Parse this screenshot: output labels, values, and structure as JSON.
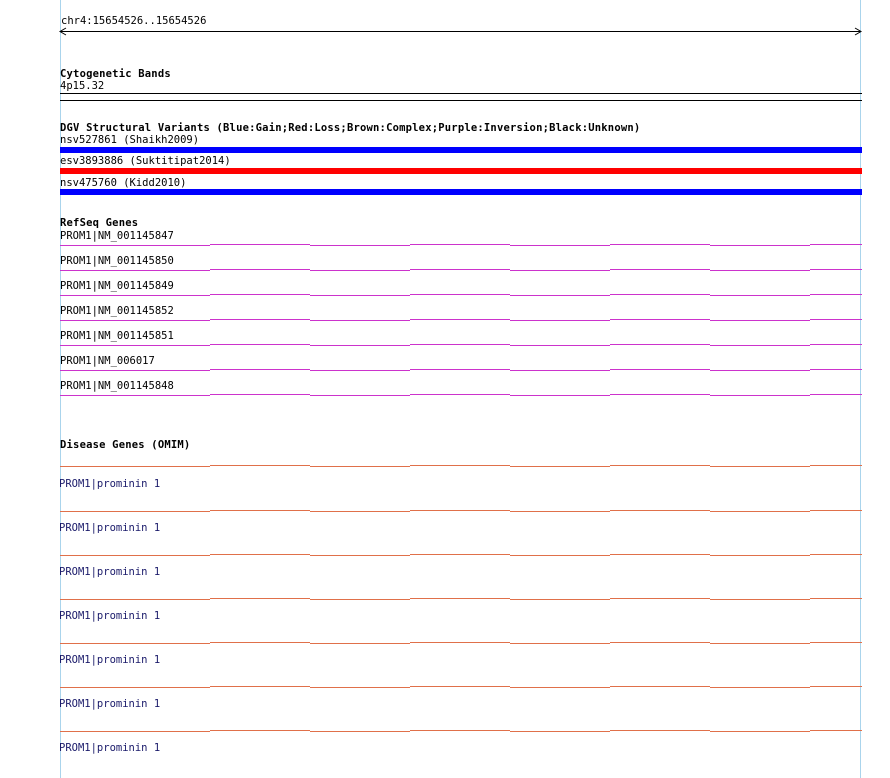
{
  "colors": {
    "guide": "#aad4ec",
    "gain": "#0000ff",
    "loss": "#ff0000",
    "refseq": "#cc33cc",
    "omim": "#e0704a"
  },
  "ruler": {
    "label": "chr4:15654526..15654526"
  },
  "cytoband": {
    "title": "Cytogenetic Bands",
    "band": "4p15.32"
  },
  "dgv": {
    "title": "DGV Structural Variants (Blue:Gain;Red:Loss;Brown:Complex;Purple:Inversion;Black:Unknown)",
    "variants": [
      {
        "label": "nsv527861 (Shaikh2009)",
        "color": "#0000ff"
      },
      {
        "label": "esv3893886 (Suktitipat2014)",
        "color": "#ff0000"
      },
      {
        "label": "nsv475760 (Kidd2010)",
        "color": "#0000ff"
      }
    ]
  },
  "refseq": {
    "title": "RefSeq Genes",
    "genes": [
      "PROM1|NM_001145847",
      "PROM1|NM_001145850",
      "PROM1|NM_001145849",
      "PROM1|NM_001145852",
      "PROM1|NM_001145851",
      "PROM1|NM_006017",
      "PROM1|NM_001145848"
    ]
  },
  "omim": {
    "title": "Disease Genes (OMIM)",
    "genes": [
      "PROM1|prominin 1",
      "PROM1|prominin 1",
      "PROM1|prominin 1",
      "PROM1|prominin 1",
      "PROM1|prominin 1",
      "PROM1|prominin 1",
      "PROM1|prominin 1"
    ]
  }
}
